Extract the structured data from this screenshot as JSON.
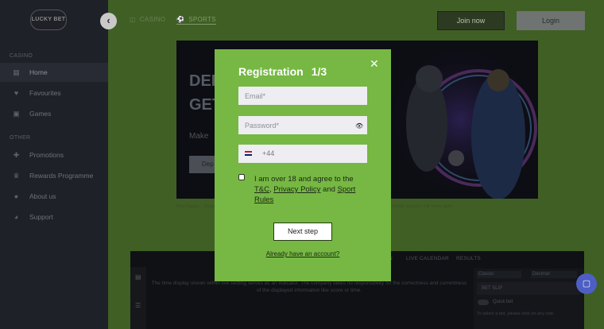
{
  "brand": {
    "logo_text": "LUCKY BET"
  },
  "sidebar": {
    "section_casino": "CASINO",
    "section_other": "OTHER",
    "items": [
      {
        "label": "Home",
        "icon": "home-grid-icon"
      },
      {
        "label": "Favourites",
        "icon": "heart-icon"
      },
      {
        "label": "Games",
        "icon": "games-icon"
      },
      {
        "label": "Promotions",
        "icon": "gift-icon"
      },
      {
        "label": "Rewards Programme",
        "icon": "trophy-icon"
      },
      {
        "label": "About us",
        "icon": "info-icon"
      },
      {
        "label": "Support",
        "icon": "support-icon"
      }
    ]
  },
  "header": {
    "back_icon": "chevron-left-icon",
    "casino_label": "CASINO",
    "sports_label": "SPORTS",
    "join_label": "Join now",
    "login_label": "Login"
  },
  "banner": {
    "line1": "DEP",
    "line2": "GET",
    "sub": "Make",
    "button": "Dep",
    "disclaimer": "New Players ... Steps from the relevant link. Please bet on this at odds and more, the above ... applies. Excluded Web and Mobile. Recipes. Full Terms apply."
  },
  "sports_panel": {
    "tab_in_play": "IN",
    "tab_live_calendar": "LIVE CALENDAR",
    "tab_results": "RESULTS",
    "notice": "The time display shown within live betting serves as an indicator. The company takes no responsibility for the correctness and currentness of the displayed information like score or time.",
    "odds_format": "Classic",
    "odds_type": "Decimal",
    "bet_slip": "BET SLIP",
    "quick_bet": "Quick bet",
    "slip_hint": "To select a bet, please click on any odd."
  },
  "modal": {
    "title": "Registration",
    "step": "1/3",
    "email_placeholder": "Email*",
    "password_placeholder": "Password*",
    "phone_prefix": "+44",
    "agree_prefix": "I am over 18 and agree to the ",
    "tc": "T&C",
    "comma": ", ",
    "privacy": "Privacy Policy",
    "and": " and ",
    "sport_rules": "Sport Rules",
    "next_label": "Next step",
    "already_label": "Already have an account?"
  },
  "colors": {
    "modal_bg": "#76b843",
    "overlay_green": "#405f24",
    "sidebar_bg": "#1f2128",
    "chat_bg": "#4d5fc4"
  }
}
